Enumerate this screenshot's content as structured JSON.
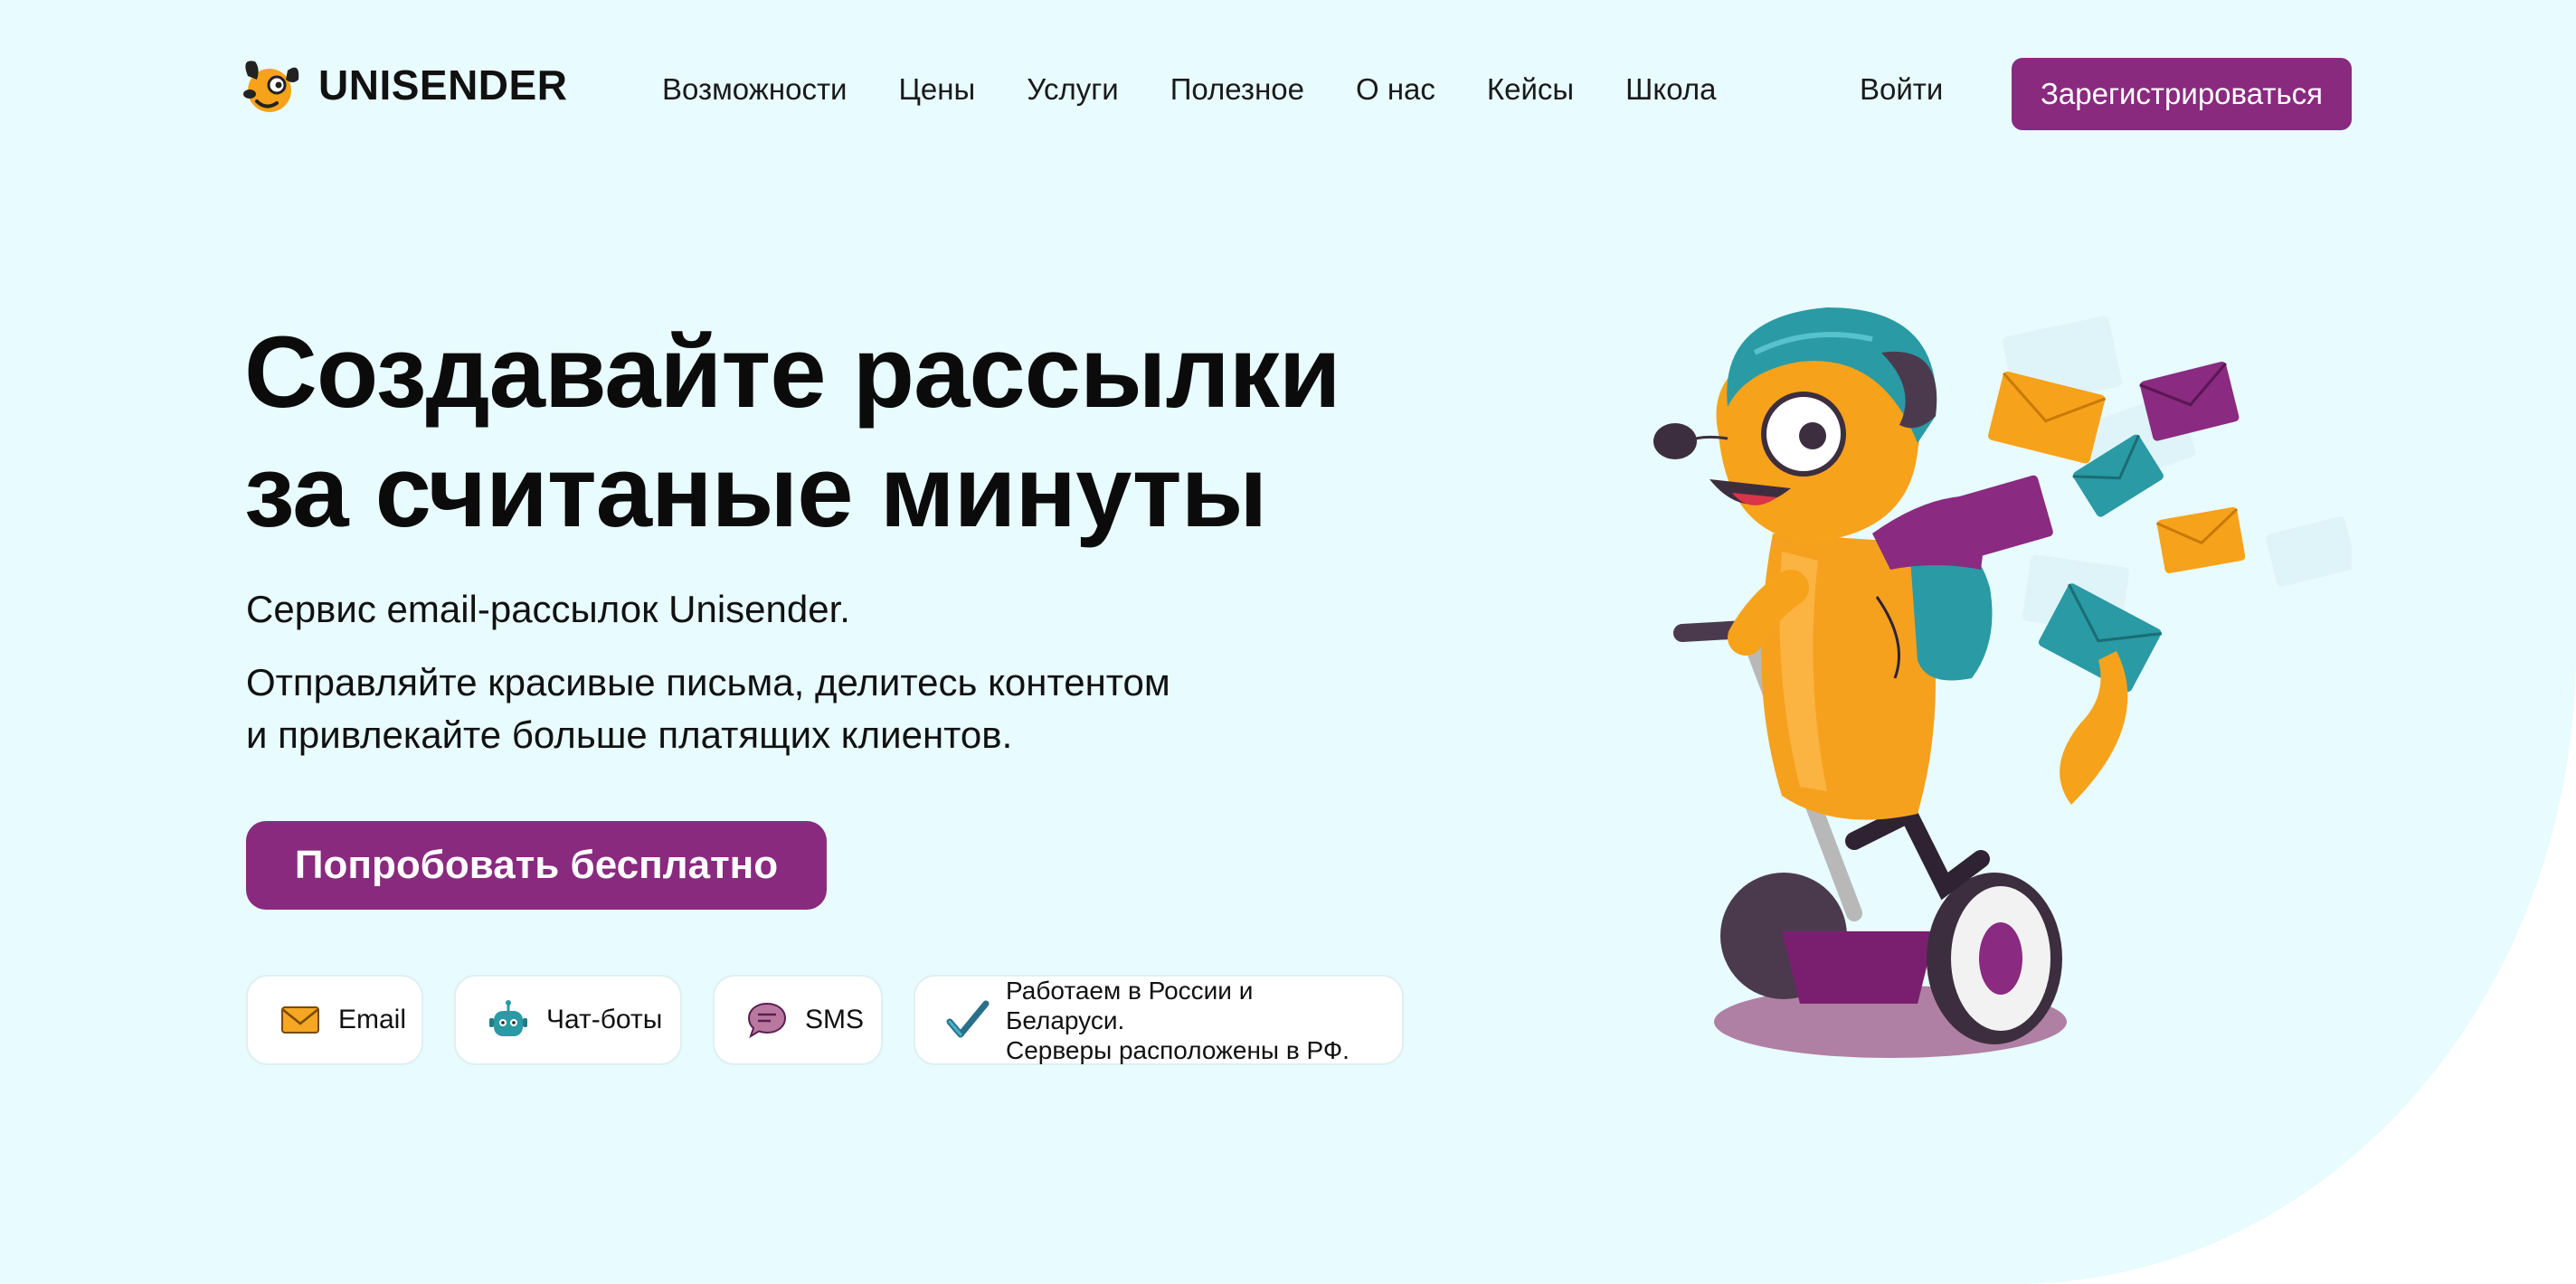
{
  "brand": {
    "name": "UNISENDER"
  },
  "nav": {
    "items": [
      "Возможности",
      "Цены",
      "Услуги",
      "Полезное",
      "О нас",
      "Кейсы",
      "Школа"
    ],
    "login": "Войти",
    "signup": "Зарегистрироваться"
  },
  "hero": {
    "headline_line1": "Создавайте рассылки",
    "headline_line2": "за считаные минуты",
    "subtitle": "Сервис email-рассылок Unisender.",
    "description_line1": "Отправляйте красивые письма, делитесь контентом",
    "description_line2": "и привлекайте больше платящих клиентов.",
    "cta": "Попробовать бесплатно"
  },
  "features": {
    "email": {
      "label": "Email",
      "icon": "envelope-icon"
    },
    "chatbots": {
      "label": "Чат-боты",
      "icon": "robot-icon"
    },
    "sms": {
      "label": "SMS",
      "icon": "chat-bubble-icon"
    },
    "note": {
      "line1": "Работаем в России и Беларуси.",
      "line2": "Серверы расположены в РФ.",
      "icon": "checkmark-icon"
    }
  },
  "colors": {
    "accent": "#892a7f",
    "background": "#e8fbfe",
    "mascot_orange": "#f7a21b",
    "helmet_teal": "#2a9aa5"
  }
}
